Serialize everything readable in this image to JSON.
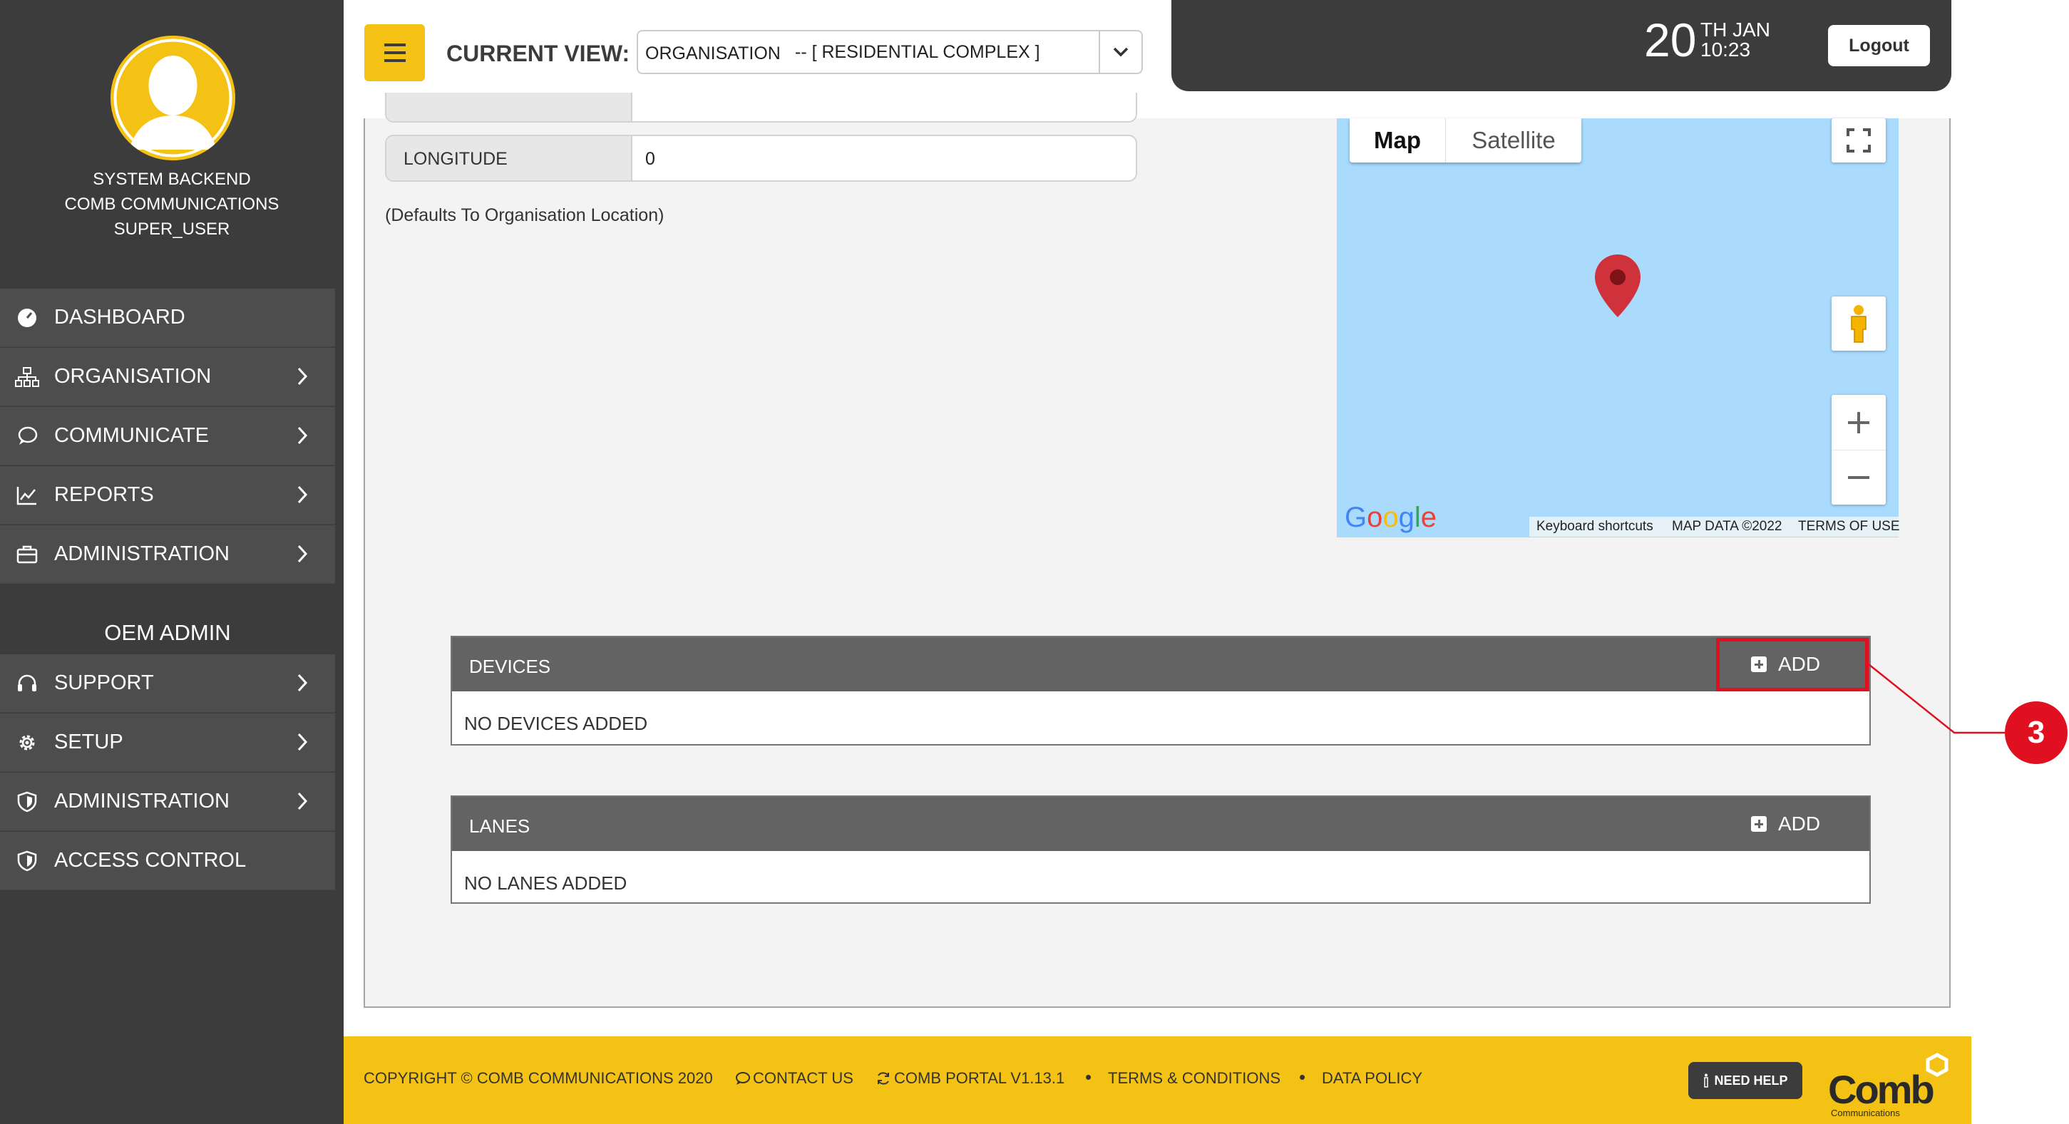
{
  "sidebar": {
    "user": {
      "line1": "SYSTEM BACKEND",
      "line2": "COMB COMMUNICATIONS",
      "line3": "SUPER_USER"
    },
    "menu": [
      {
        "label": "DASHBOARD",
        "icon": "dashboard-icon",
        "has_chevron": false
      },
      {
        "label": "ORGANISATION",
        "icon": "org-chart-icon",
        "has_chevron": true
      },
      {
        "label": "COMMUNICATE",
        "icon": "chat-bubble-icon",
        "has_chevron": true
      },
      {
        "label": "REPORTS",
        "icon": "line-chart-icon",
        "has_chevron": true
      },
      {
        "label": "ADMINISTRATION",
        "icon": "briefcase-icon",
        "has_chevron": true
      }
    ],
    "oem_title": "OEM ADMIN",
    "oem_menu": [
      {
        "label": "SUPPORT",
        "icon": "headset-icon",
        "has_chevron": true
      },
      {
        "label": "SETUP",
        "icon": "gear-icon",
        "has_chevron": true
      },
      {
        "label": "ADMINISTRATION",
        "icon": "shield-icon",
        "has_chevron": true
      },
      {
        "label": "ACCESS CONTROL",
        "icon": "shield-icon",
        "has_chevron": false
      }
    ]
  },
  "header": {
    "current_view_label": "CURRENT VIEW:",
    "select": {
      "left_text": "ORGANISATION",
      "selected": "-- [ RESIDENTIAL COMPLEX ]"
    },
    "date": {
      "day": "20",
      "month": "TH JAN",
      "time": "10:23"
    },
    "logout_label": "Logout"
  },
  "form": {
    "longitude_label": "LONGITUDE",
    "longitude_value": "0",
    "defaults_note": "(Defaults To Organisation Location)"
  },
  "map": {
    "tabs": [
      "Map",
      "Satellite"
    ],
    "active_tab": "Map",
    "google_logo": "Google",
    "attribution": [
      "Keyboard shortcuts",
      "MAP DATA ©2022",
      "TERMS OF USE"
    ],
    "water_color": "#aadafc",
    "marker_color": "#d0323b"
  },
  "devices": {
    "title": "DEVICES",
    "add_label": "ADD",
    "empty_text": "NO DEVICES ADDED"
  },
  "lanes": {
    "title": "LANES",
    "add_label": "ADD",
    "empty_text": "NO LANES ADDED"
  },
  "callout": {
    "number": "3",
    "color": "#e01020"
  },
  "footer": {
    "copyright": "COPYRIGHT © COMB COMMUNICATIONS 2020",
    "contact": "CONTACT US",
    "portal": "COMB PORTAL V1.13.1",
    "terms": "TERMS & CONDITIONS",
    "data_policy": "DATA POLICY",
    "need_help": "NEED HELP",
    "logo_text": "Comb",
    "logo_sub": "Communications"
  },
  "colors": {
    "accent": "#f4c214",
    "dark": "#3c3c3c",
    "header_bar": "#636363"
  }
}
